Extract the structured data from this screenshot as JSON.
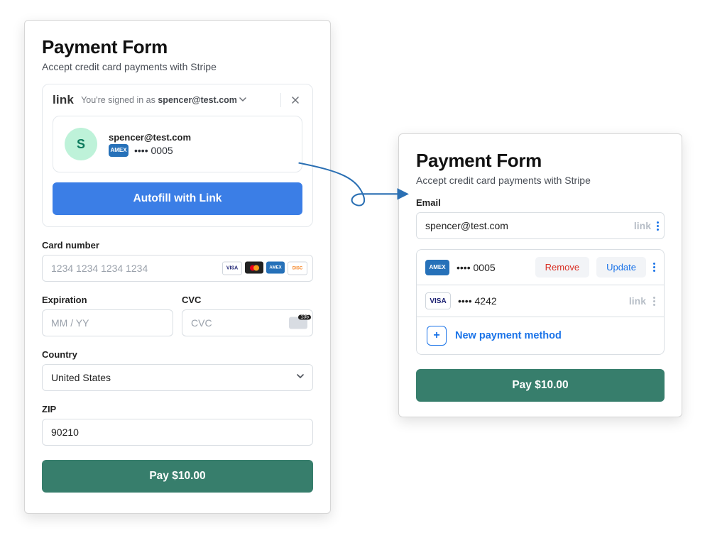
{
  "left": {
    "title": "Payment Form",
    "subtitle": "Accept credit card payments with Stripe",
    "link_brand": "link",
    "signed_in_prefix": "You're signed in as ",
    "signed_in_email": "spencer@test.com",
    "avatar_initial": "S",
    "saved_email": "spencer@test.com",
    "saved_card_brand_label": "AMEX",
    "saved_masked": "•••• 0005",
    "autofill_label": "Autofill with Link",
    "labels": {
      "card": "Card number",
      "exp": "Expiration",
      "cvc": "CVC",
      "country": "Country",
      "zip": "ZIP"
    },
    "placeholders": {
      "card": "1234 1234 1234 1234",
      "exp": "MM / YY",
      "cvc": "CVC"
    },
    "country_value": "United States",
    "zip_value": "90210",
    "pay_label": "Pay $10.00"
  },
  "right": {
    "title": "Payment Form",
    "subtitle": "Accept credit card payments with Stripe",
    "email_label": "Email",
    "email_value": "spencer@test.com",
    "link_brand": "link",
    "methods": [
      {
        "brand": "amex",
        "brand_label": "AMEX",
        "masked": "•••• 0005",
        "actions": {
          "remove": "Remove",
          "update": "Update"
        }
      },
      {
        "brand": "visa",
        "brand_label": "VISA",
        "masked": "•••• 4242",
        "link_brand": "link"
      }
    ],
    "new_method_label": "New payment method",
    "pay_label": "Pay $10.00"
  }
}
